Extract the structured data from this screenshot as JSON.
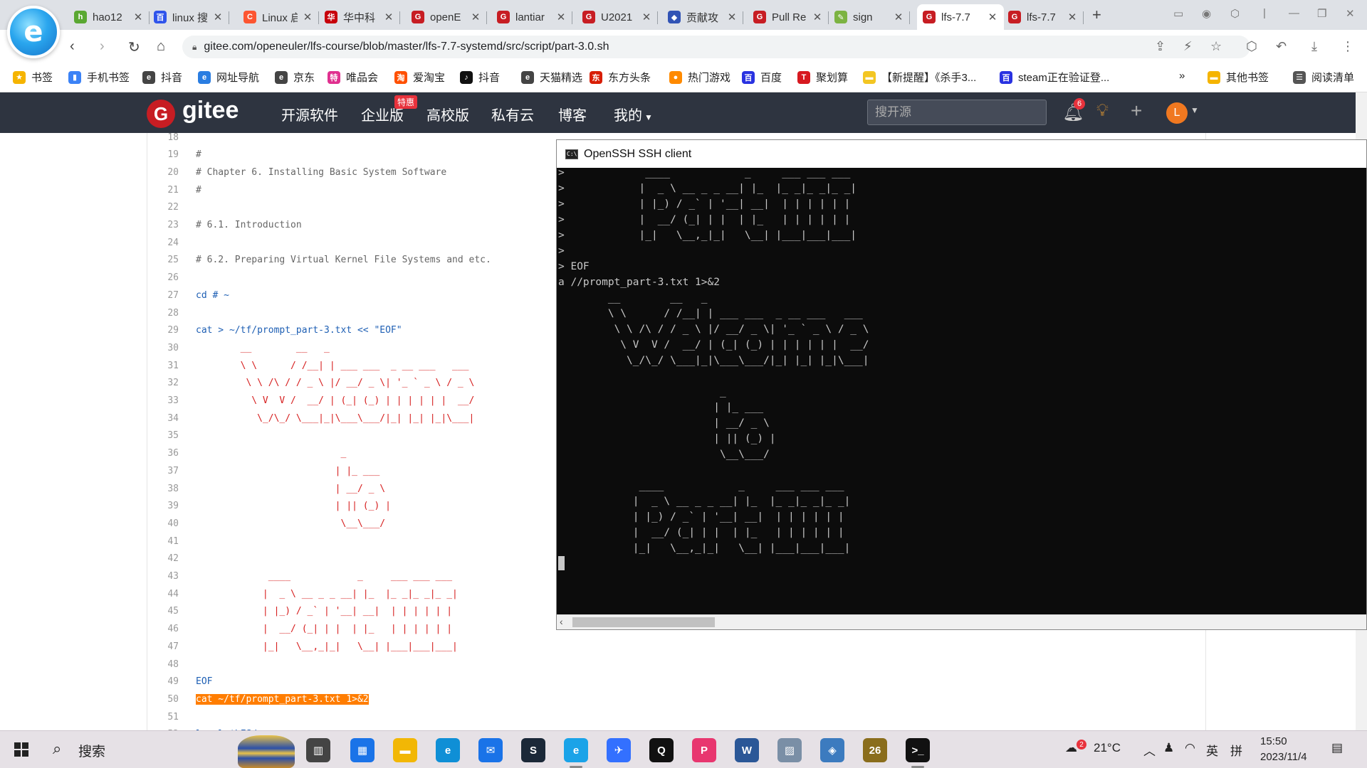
{
  "tabs": [
    {
      "label": "hao12",
      "icon_color": "#5aa832",
      "icon_char": "h",
      "active": false
    },
    {
      "label": "linux 搜",
      "icon_color": "#2f54eb",
      "icon_char": "百",
      "active": false
    },
    {
      "label": "Linux 启",
      "icon_color": "#fc5531",
      "icon_char": "C",
      "active": false
    },
    {
      "label": "华中科",
      "icon_color": "#c7000b",
      "icon_char": "华",
      "active": false
    },
    {
      "label": "openE",
      "icon_color": "#c71d23",
      "icon_char": "G",
      "active": false
    },
    {
      "label": "lantiar",
      "icon_color": "#c71d23",
      "icon_char": "G",
      "active": false
    },
    {
      "label": "U2021",
      "icon_color": "#c71d23",
      "icon_char": "G",
      "active": false
    },
    {
      "label": "贡献攻",
      "icon_color": "#3153b5",
      "icon_char": "◆",
      "active": false
    },
    {
      "label": "Pull Re",
      "icon_color": "#c71d23",
      "icon_char": "G",
      "active": false
    },
    {
      "label": "sign",
      "icon_color": "#7cb342",
      "icon_char": "✎",
      "active": false
    },
    {
      "label": "lfs-7.7",
      "icon_color": "#c71d23",
      "icon_char": "G",
      "active": true
    },
    {
      "label": "lfs-7.7",
      "icon_color": "#c71d23",
      "icon_char": "G",
      "active": false
    }
  ],
  "browser": {
    "url": "gitee.com/openeuler/lfs-course/blob/master/lfs-7.7-systemd/src/script/part-3.0.sh"
  },
  "bookmarks": [
    {
      "label": "书签",
      "icon_color": "#f5b400",
      "icon_char": "★"
    },
    {
      "label": "手机书签",
      "icon_color": "#3b82f6",
      "icon_char": "▮"
    },
    {
      "label": "抖音",
      "icon_color": "#444444",
      "icon_char": "e"
    },
    {
      "label": "网址导航",
      "icon_color": "#2a7de1",
      "icon_char": "e"
    },
    {
      "label": "京东",
      "icon_color": "#444444",
      "icon_char": "e"
    },
    {
      "label": "唯品会",
      "icon_color": "#e0308f",
      "icon_char": "特"
    },
    {
      "label": "爱淘宝",
      "icon_color": "#ff5000",
      "icon_char": "淘"
    },
    {
      "label": "抖音",
      "icon_color": "#111111",
      "icon_char": "♪"
    },
    {
      "label": "天猫精选",
      "icon_color": "#444444",
      "icon_char": "e"
    },
    {
      "label": "东方头条",
      "icon_color": "#d81e06",
      "icon_char": "东"
    },
    {
      "label": "热门游戏",
      "icon_color": "#ff8a00",
      "icon_char": "●"
    },
    {
      "label": "百度",
      "icon_color": "#2932e1",
      "icon_char": "百"
    },
    {
      "label": "聚划算",
      "icon_color": "#d71920",
      "icon_char": "T"
    },
    {
      "label": "【新提醒】《杀手3...",
      "icon_color": "#f3c623",
      "icon_char": "▬"
    },
    {
      "label": "steam正在验证登...",
      "icon_color": "#2932e1",
      "icon_char": "百"
    },
    {
      "label": "其他书签",
      "icon_color": "#f5b400",
      "icon_char": "▬"
    },
    {
      "label": "阅读清单",
      "icon_color": "#555555",
      "icon_char": "☰"
    }
  ],
  "bookmarks_overflow": "»",
  "gitee": {
    "logo": "gitee",
    "logo_mark": "G",
    "nav": [
      "开源软件",
      "企业版",
      "高校版",
      "私有云",
      "博客",
      "我的"
    ],
    "badge": "特惠",
    "search_placeholder": "搜开源",
    "notif_count": "6",
    "avatar_letter": "L"
  },
  "code": {
    "lines": [
      {
        "n": "18",
        "t": "",
        "k": "plain"
      },
      {
        "n": "19",
        "t": "#",
        "k": "comment"
      },
      {
        "n": "20",
        "t": "# Chapter 6. Installing Basic System Software",
        "k": "comment"
      },
      {
        "n": "21",
        "t": "#",
        "k": "comment"
      },
      {
        "n": "22",
        "t": "",
        "k": "plain"
      },
      {
        "n": "23",
        "t": "# 6.1. Introduction",
        "k": "comment"
      },
      {
        "n": "24",
        "t": "",
        "k": "plain"
      },
      {
        "n": "25",
        "t": "# 6.2. Preparing Virtual Kernel File Systems and etc.",
        "k": "comment"
      },
      {
        "n": "26",
        "t": "",
        "k": "plain"
      },
      {
        "n": "27",
        "t": "cd # ~",
        "k": "cmd"
      },
      {
        "n": "28",
        "t": "",
        "k": "plain"
      },
      {
        "n": "29",
        "t": "cat > ~/tf/prompt_part-3.txt << \"EOF\"",
        "k": "cmd"
      },
      {
        "n": "30",
        "t": "        __        __   _",
        "k": "art"
      },
      {
        "n": "31",
        "t": "        \\ \\      / /__| | ___ ___  _ __ ___   ___",
        "k": "art"
      },
      {
        "n": "32",
        "t": "         \\ \\ /\\ / / _ \\ |/ __/ _ \\| '_ ` _ \\ / _ \\",
        "k": "art"
      },
      {
        "n": "33",
        "t": "          \\ V  V /  __/ | (_| (_) | | | | | |  __/",
        "k": "art"
      },
      {
        "n": "34",
        "t": "           \\_/\\_/ \\___|_|\\___\\___/|_| |_| |_|\\___|",
        "k": "art"
      },
      {
        "n": "35",
        "t": "",
        "k": "plain"
      },
      {
        "n": "36",
        "t": "                          _",
        "k": "art"
      },
      {
        "n": "37",
        "t": "                         | |_ ___",
        "k": "art"
      },
      {
        "n": "38",
        "t": "                         | __/ _ \\",
        "k": "art"
      },
      {
        "n": "39",
        "t": "                         | || (_) |",
        "k": "art"
      },
      {
        "n": "40",
        "t": "                          \\__\\___/",
        "k": "art"
      },
      {
        "n": "41",
        "t": "",
        "k": "plain"
      },
      {
        "n": "42",
        "t": "",
        "k": "plain"
      },
      {
        "n": "43",
        "t": "             ____            _     ___ ___ ___",
        "k": "art"
      },
      {
        "n": "44",
        "t": "            |  _ \\ __ _ _ __| |_  |_ _|_ _|_ _|",
        "k": "art"
      },
      {
        "n": "45",
        "t": "            | |_) / _` | '__| __|  | | | | | |",
        "k": "art"
      },
      {
        "n": "46",
        "t": "            |  __/ (_| | |  | |_   | | | | | |",
        "k": "art"
      },
      {
        "n": "47",
        "t": "            |_|   \\__,_|_|   \\__| |___|___|___|",
        "k": "art"
      },
      {
        "n": "48",
        "t": "",
        "k": "plain"
      },
      {
        "n": "49",
        "t": "EOF",
        "k": "cmd"
      },
      {
        "n": "50",
        "t": "cat ~/tf/prompt_part-3.txt 1>&2",
        "k": "hl"
      },
      {
        "n": "51",
        "t": "",
        "k": "plain"
      },
      {
        "n": "52",
        "t": "ls -l $LFS/",
        "k": "cmd"
      }
    ]
  },
  "ssh": {
    "title": "OpenSSH SSH client",
    "lines": [
      ">             ____            _     ___ ___ ___",
      ">            |  _ \\ __ _ _ __| |_  |_ _|_ _|_ _|",
      ">            | |_) / _` | '__| __|  | | | | | |",
      ">            |  __/ (_| | |  | |_   | | | | | |",
      ">            |_|   \\__,_|_|   \\__| |___|___|___|",
      ">",
      "> EOF",
      "a //prompt_part-3.txt 1>&2",
      "        __        __   _",
      "        \\ \\      / /__| | ___ ___  _ __ ___   ___",
      "         \\ \\ /\\ / / _ \\ |/ __/ _ \\| '_ ` _ \\ / _ \\",
      "          \\ V  V /  __/ | (_| (_) | | | | | |  __/",
      "           \\_/\\_/ \\___|_|\\___\\___/|_| |_| |_|\\___|",
      "",
      "                          _",
      "                         | |_ ___",
      "                         | __/ _ \\",
      "                         | || (_) |",
      "                          \\__\\___/",
      "",
      "             ____            _     ___ ___ ___",
      "            |  _ \\ __ _ _ __| |_  |_ _|_ _|_ _|",
      "            | |_) / _` | '__| __|  | | | | | |",
      "            |  __/ (_| | |  | |_   | | | | | |",
      "            |_|   \\__,_|_|   \\__| |___|___|___|"
    ]
  },
  "taskbar": {
    "search_label": "搜索",
    "apps": [
      {
        "name": "task-view",
        "color": "#444444",
        "char": "▥",
        "open": false
      },
      {
        "name": "store",
        "color": "#1a73e8",
        "char": "▦",
        "open": false
      },
      {
        "name": "file-explorer",
        "color": "#f2b705",
        "char": "▬",
        "open": false
      },
      {
        "name": "edge",
        "color": "#0f8fd6",
        "char": "e",
        "open": false
      },
      {
        "name": "mail",
        "color": "#1a73e8",
        "char": "✉",
        "open": false
      },
      {
        "name": "steam",
        "color": "#1b2838",
        "char": "S",
        "open": false
      },
      {
        "name": "browser-2345",
        "color": "#1aa3e8",
        "char": "e",
        "open": true
      },
      {
        "name": "feishu",
        "color": "#3370ff",
        "char": "✈",
        "open": false
      },
      {
        "name": "qq",
        "color": "#111111",
        "char": "Q",
        "open": false
      },
      {
        "name": "pdf",
        "color": "#e8366f",
        "char": "P",
        "open": false
      },
      {
        "name": "word",
        "color": "#2b5797",
        "char": "W",
        "open": false
      },
      {
        "name": "photos",
        "color": "#7a8fa6",
        "char": "▨",
        "open": false
      },
      {
        "name": "virtualbox",
        "color": "#3c7bbf",
        "char": "◈",
        "open": false
      },
      {
        "name": "cpu-z",
        "color": "#8a6d1c",
        "char": "26",
        "open": false
      },
      {
        "name": "terminal",
        "color": "#111111",
        "char": ">_",
        "open": true
      }
    ],
    "weather": "21°C",
    "ime_lang": "英",
    "ime_mode": "拼",
    "time": "15:50",
    "date": "2023/11/4",
    "notif_count": "2"
  }
}
